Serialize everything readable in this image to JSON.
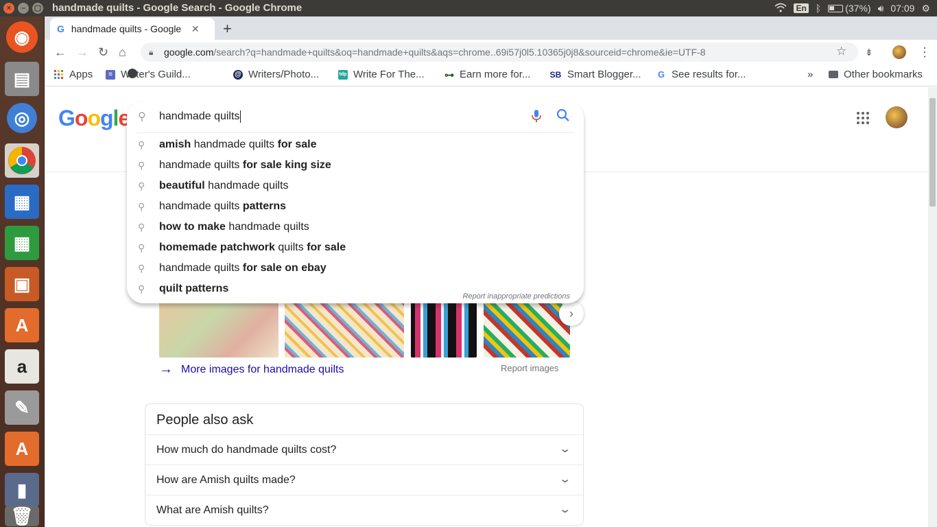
{
  "os": {
    "window_title": "handmade quilts - Google Search - Google Chrome",
    "keyboard_layout": "En",
    "battery": "(37%)",
    "clock": "07:09"
  },
  "browser": {
    "tab_title": "handmade quilts - Google",
    "url_host": "google.com",
    "url_path": "/search?q=handmade+quilts&oq=handmade+quilts&aqs=chrome..69i57j0l5.10365j0j8&sourceid=chrome&ie=UTF-8",
    "bookmarks": [
      {
        "label": "Apps"
      },
      {
        "label": "Writer's Guild..."
      },
      {
        "label": "Writers/Photo..."
      },
      {
        "label": "Write For The..."
      },
      {
        "label": "Earn more for..."
      },
      {
        "label": "Smart Blogger..."
      },
      {
        "label": "See results for..."
      }
    ],
    "overflow": "»",
    "other_bookmarks": "Other bookmarks"
  },
  "search": {
    "logo_letters": [
      "G",
      "o",
      "o",
      "g",
      "l",
      "e"
    ],
    "logo_colors": [
      "#4285f4",
      "#ea4335",
      "#fbbc05",
      "#4285f4",
      "#34a853",
      "#ea4335"
    ],
    "query": "handmade quilts",
    "suggestions": [
      {
        "pre_bold": "amish",
        "plain": " handmade quilts ",
        "post_bold": "for sale"
      },
      {
        "pre_bold": "",
        "plain": "handmade quilts ",
        "post_bold": "for sale king size"
      },
      {
        "pre_bold": "beautiful",
        "plain": " handmade quilts",
        "post_bold": ""
      },
      {
        "pre_bold": "",
        "plain": "handmade quilts ",
        "post_bold": "patterns"
      },
      {
        "pre_bold": "how to make",
        "plain": " handmade quilts",
        "post_bold": ""
      },
      {
        "pre_bold": "homemade patchwork",
        "plain": " quilts ",
        "post_bold": "for sale"
      },
      {
        "pre_bold": "",
        "plain": "handmade quilts ",
        "post_bold": "for sale on ebay"
      },
      {
        "pre_bold": "quilt patterns",
        "plain": "",
        "post_bold": ""
      }
    ],
    "report_predictions": "Report inappropriate predictions",
    "more_images": "More images for handmade quilts",
    "report_images": "Report images",
    "people_also_ask": {
      "title": "People also ask",
      "questions": [
        "How much do handmade quilts cost?",
        "How are Amish quilts made?",
        "What are Amish quilts?"
      ]
    }
  }
}
